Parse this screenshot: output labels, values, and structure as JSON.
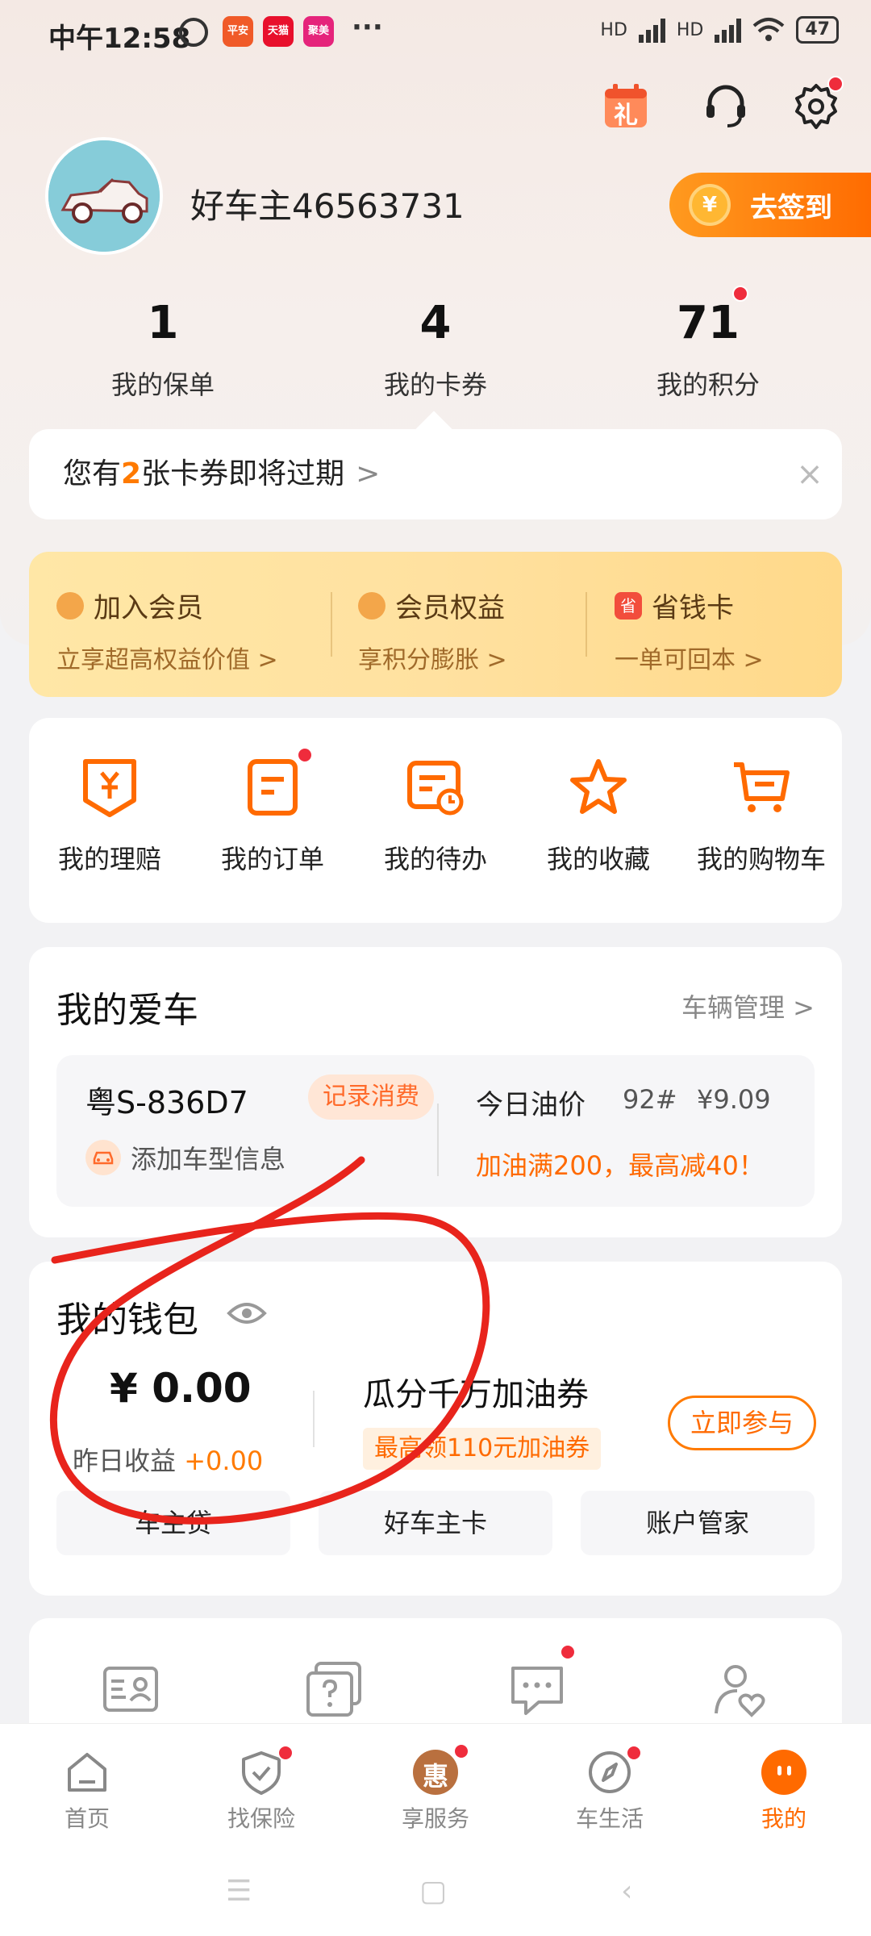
{
  "status_bar": {
    "time": "中午12:58",
    "apps": [
      {
        "name": "bank-app-icon",
        "label": "平安银行",
        "color": "#f05a28"
      },
      {
        "name": "tmall-icon",
        "label": "天猫",
        "color": "#e8102c"
      },
      {
        "name": "jumei-icon",
        "label": "聚美",
        "color": "#e5247b"
      }
    ],
    "more": "···",
    "network": [
      "HD",
      "HD"
    ],
    "battery": "47"
  },
  "header": {
    "gift_label": "礼"
  },
  "profile": {
    "username": "好车主46563731",
    "signin_label": "去签到",
    "coin_symbol": "¥"
  },
  "stats": [
    {
      "value": "1",
      "label": "我的保单"
    },
    {
      "value": "4",
      "label": "我的卡券"
    },
    {
      "value": "71",
      "label": "我的积分"
    }
  ],
  "notice": {
    "prefix": "您有",
    "count": "2",
    "suffix": "张卡券即将过期",
    "chevron": ">",
    "close": "×"
  },
  "member": [
    {
      "title": "加入会员",
      "sub": "立享超高权益价值 >"
    },
    {
      "title": "会员权益",
      "sub": "享积分膨胀 >"
    },
    {
      "title": "省钱卡",
      "sub": "一单可回本 >",
      "icon_text": "省"
    }
  ],
  "quick_actions": [
    {
      "label": "我的理赔"
    },
    {
      "label": "我的订单"
    },
    {
      "label": "我的待办"
    },
    {
      "label": "我的收藏"
    },
    {
      "label": "我的购物车"
    }
  ],
  "my_car": {
    "title": "我的爱车",
    "manage_link": "车辆管理 >",
    "plate": "粤S-836D7",
    "record_tag": "记录消费",
    "add_model": "添加车型信息",
    "oil_title": "今日油价",
    "oil_grade": "92#",
    "oil_price": "¥9.09",
    "oil_promo": "加油满200，最高减40！"
  },
  "wallet": {
    "title": "我的钱包",
    "balance": "¥ 0.00",
    "yesterday_label": "昨日收益",
    "yesterday_value": "+0.00",
    "promo_title": "瓜分千万加油券",
    "promo_tag": "最高领110元加油券",
    "join_label": "立即参与",
    "buttons": [
      "车主贷",
      "好车主卡",
      "账户管家"
    ]
  },
  "bottom_nav": [
    {
      "label": "首页"
    },
    {
      "label": "找保险"
    },
    {
      "label": "享服务",
      "icon_text": "惠"
    },
    {
      "label": "车生活"
    },
    {
      "label": "我的"
    }
  ],
  "colors": {
    "accent": "#ff6a00",
    "badge": "#ef2c3c",
    "annotation": "#e8241c"
  }
}
